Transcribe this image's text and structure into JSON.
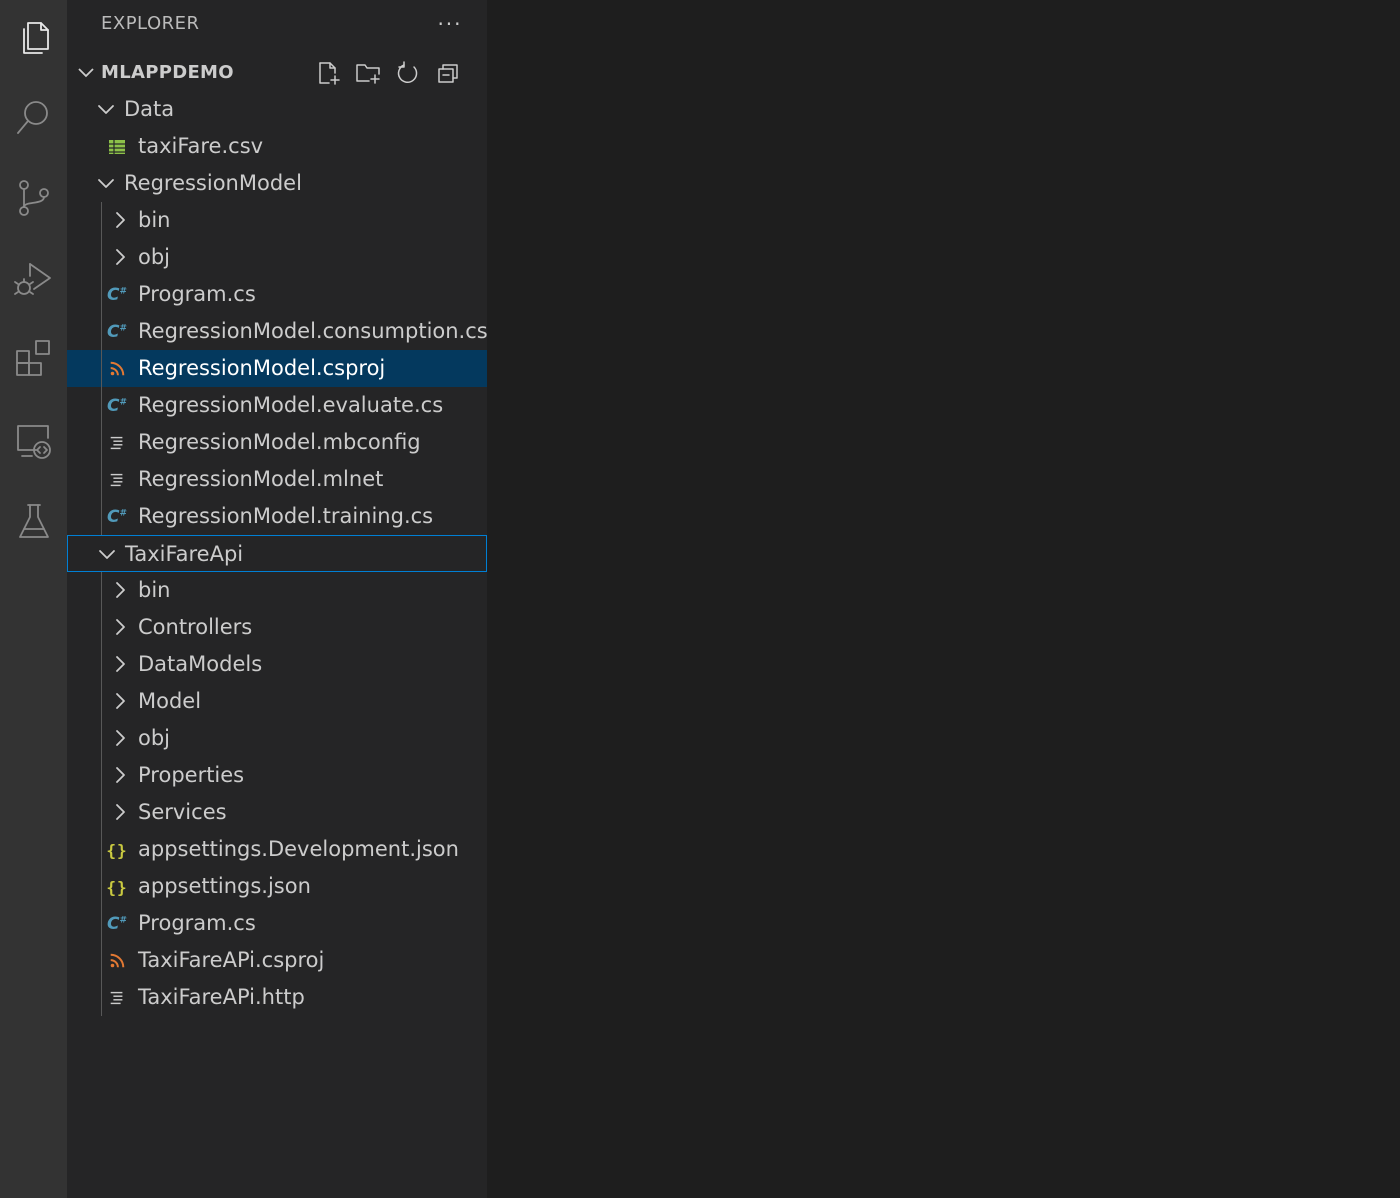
{
  "explorer": {
    "title": "EXPLORER",
    "more_actions": "···"
  },
  "workspace": {
    "name": "MLAPPDEMO",
    "actions": [
      {
        "icon": "new-file-icon"
      },
      {
        "icon": "new-folder-icon"
      },
      {
        "icon": "refresh-icon"
      },
      {
        "icon": "collapse-all-icon"
      }
    ]
  },
  "activity_bar": {
    "items": [
      {
        "icon": "explorer-icon",
        "active": true
      },
      {
        "icon": "search-icon"
      },
      {
        "icon": "source-control-icon"
      },
      {
        "icon": "run-debug-icon"
      },
      {
        "icon": "extensions-icon"
      },
      {
        "icon": "remote-explorer-icon"
      },
      {
        "icon": "testing-icon"
      }
    ]
  },
  "tree": [
    {
      "label": "Data",
      "type": "folder",
      "expanded": true,
      "depth": 1
    },
    {
      "label": "taxiFare.csv",
      "type": "csv",
      "depth": 2
    },
    {
      "label": "RegressionModel",
      "type": "folder",
      "expanded": true,
      "depth": 1
    },
    {
      "label": "bin",
      "type": "folder",
      "expanded": false,
      "depth": 2
    },
    {
      "label": "obj",
      "type": "folder",
      "expanded": false,
      "depth": 2
    },
    {
      "label": "Program.cs",
      "type": "cs",
      "depth": 2
    },
    {
      "label": "RegressionModel.consumption.cs",
      "type": "cs",
      "depth": 2
    },
    {
      "label": "RegressionModel.csproj",
      "type": "csproj",
      "depth": 2,
      "selected": true
    },
    {
      "label": "RegressionModel.evaluate.cs",
      "type": "cs",
      "depth": 2
    },
    {
      "label": "RegressionModel.mbconfig",
      "type": "text",
      "depth": 2
    },
    {
      "label": "RegressionModel.mlnet",
      "type": "text",
      "depth": 2
    },
    {
      "label": "RegressionModel.training.cs",
      "type": "cs",
      "depth": 2
    },
    {
      "label": "TaxiFareApi",
      "type": "folder",
      "expanded": true,
      "depth": 1,
      "focused": true
    },
    {
      "label": "bin",
      "type": "folder",
      "expanded": false,
      "depth": 2
    },
    {
      "label": "Controllers",
      "type": "folder",
      "expanded": false,
      "depth": 2
    },
    {
      "label": "DataModels",
      "type": "folder",
      "expanded": false,
      "depth": 2
    },
    {
      "label": "Model",
      "type": "folder",
      "expanded": false,
      "depth": 2
    },
    {
      "label": "obj",
      "type": "folder",
      "expanded": false,
      "depth": 2
    },
    {
      "label": "Properties",
      "type": "folder",
      "expanded": false,
      "depth": 2
    },
    {
      "label": "Services",
      "type": "folder",
      "expanded": false,
      "depth": 2
    },
    {
      "label": "appsettings.Development.json",
      "type": "json",
      "depth": 2
    },
    {
      "label": "appsettings.json",
      "type": "json",
      "depth": 2
    },
    {
      "label": "Program.cs",
      "type": "cs",
      "depth": 2
    },
    {
      "label": "TaxiFareAPi.csproj",
      "type": "csproj",
      "depth": 2
    },
    {
      "label": "TaxiFareAPi.http",
      "type": "text",
      "depth": 2
    }
  ],
  "colors": {
    "activity_bar": "#333333",
    "sidebar": "#252526",
    "editor": "#1e1e1e",
    "selection": "#04395e",
    "focus_border": "#007fd4",
    "csharp": "#519aba",
    "csproj": "#e37933",
    "json": "#cbcb41",
    "csv": "#8dc149"
  }
}
